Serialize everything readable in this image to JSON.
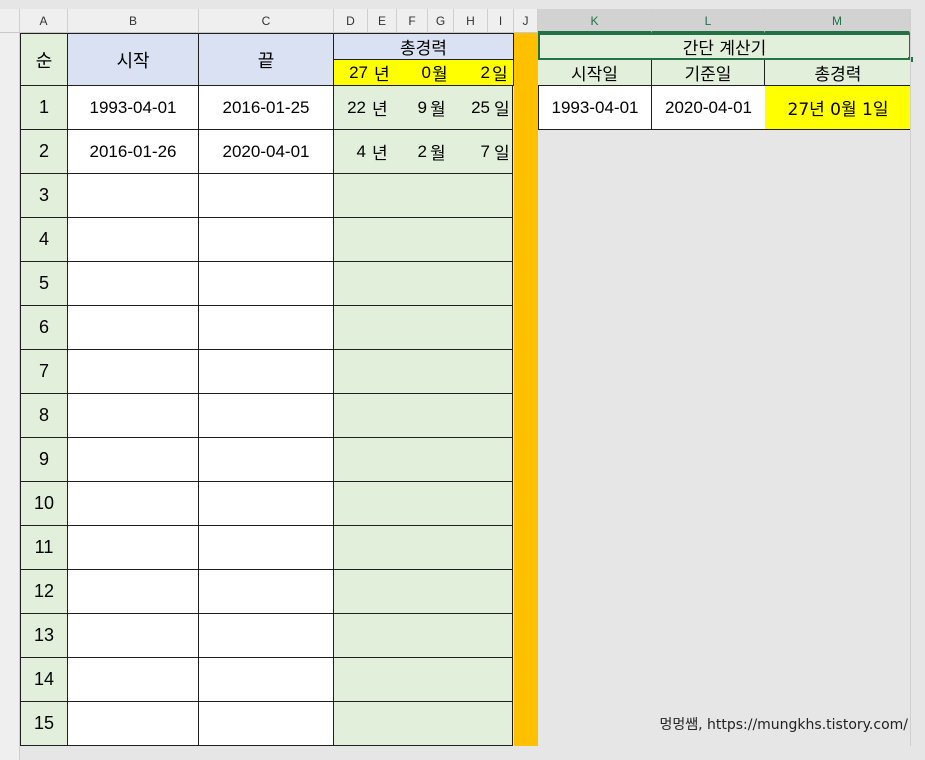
{
  "column_headers": [
    "A",
    "B",
    "C",
    "D",
    "E",
    "F",
    "G",
    "H",
    "I",
    "J",
    "K",
    "L",
    "M"
  ],
  "table": {
    "header_order": "순",
    "header_start": "시작",
    "header_end": "끝",
    "header_total": "총경력",
    "summary": {
      "years": "27",
      "year_unit": "년",
      "months": "0",
      "month_unit": "월",
      "days": "2",
      "day_unit": "일"
    },
    "rows": [
      {
        "no": "1",
        "start": "1993-04-01",
        "end": "2016-01-25",
        "years": "22",
        "year_unit": "년",
        "months": "9",
        "month_unit": "월",
        "days": "25",
        "day_unit": "일"
      },
      {
        "no": "2",
        "start": "2016-01-26",
        "end": "2020-04-01",
        "years": "4",
        "year_unit": "년",
        "months": "2",
        "month_unit": "월",
        "days": "7",
        "day_unit": "일"
      },
      {
        "no": "3",
        "start": "",
        "end": "",
        "years": "",
        "year_unit": "",
        "months": "",
        "month_unit": "",
        "days": "",
        "day_unit": ""
      },
      {
        "no": "4",
        "start": "",
        "end": "",
        "years": "",
        "year_unit": "",
        "months": "",
        "month_unit": "",
        "days": "",
        "day_unit": ""
      },
      {
        "no": "5",
        "start": "",
        "end": "",
        "years": "",
        "year_unit": "",
        "months": "",
        "month_unit": "",
        "days": "",
        "day_unit": ""
      },
      {
        "no": "6",
        "start": "",
        "end": "",
        "years": "",
        "year_unit": "",
        "months": "",
        "month_unit": "",
        "days": "",
        "day_unit": ""
      },
      {
        "no": "7",
        "start": "",
        "end": "",
        "years": "",
        "year_unit": "",
        "months": "",
        "month_unit": "",
        "days": "",
        "day_unit": ""
      },
      {
        "no": "8",
        "start": "",
        "end": "",
        "years": "",
        "year_unit": "",
        "months": "",
        "month_unit": "",
        "days": "",
        "day_unit": ""
      },
      {
        "no": "9",
        "start": "",
        "end": "",
        "years": "",
        "year_unit": "",
        "months": "",
        "month_unit": "",
        "days": "",
        "day_unit": ""
      },
      {
        "no": "10",
        "start": "",
        "end": "",
        "years": "",
        "year_unit": "",
        "months": "",
        "month_unit": "",
        "days": "",
        "day_unit": ""
      },
      {
        "no": "11",
        "start": "",
        "end": "",
        "years": "",
        "year_unit": "",
        "months": "",
        "month_unit": "",
        "days": "",
        "day_unit": ""
      },
      {
        "no": "12",
        "start": "",
        "end": "",
        "years": "",
        "year_unit": "",
        "months": "",
        "month_unit": "",
        "days": "",
        "day_unit": ""
      },
      {
        "no": "13",
        "start": "",
        "end": "",
        "years": "",
        "year_unit": "",
        "months": "",
        "month_unit": "",
        "days": "",
        "day_unit": ""
      },
      {
        "no": "14",
        "start": "",
        "end": "",
        "years": "",
        "year_unit": "",
        "months": "",
        "month_unit": "",
        "days": "",
        "day_unit": ""
      },
      {
        "no": "15",
        "start": "",
        "end": "",
        "years": "",
        "year_unit": "",
        "months": "",
        "month_unit": "",
        "days": "",
        "day_unit": ""
      }
    ]
  },
  "calculator": {
    "title": "간단 계산기",
    "label_start": "시작일",
    "label_base": "기준일",
    "label_total": "총경력",
    "start_value": "1993-04-01",
    "base_value": "2020-04-01",
    "total_value": "27년 0월 1일"
  },
  "footer_credit": "멍멍쌤, https://mungkhs.tistory.com/",
  "colors": {
    "row_header_green": "#e2efda",
    "header_blue": "#d9e1f2",
    "highlight_yellow": "#ffff00",
    "separator_orange": "#ffc000",
    "selection_green": "#217346"
  }
}
